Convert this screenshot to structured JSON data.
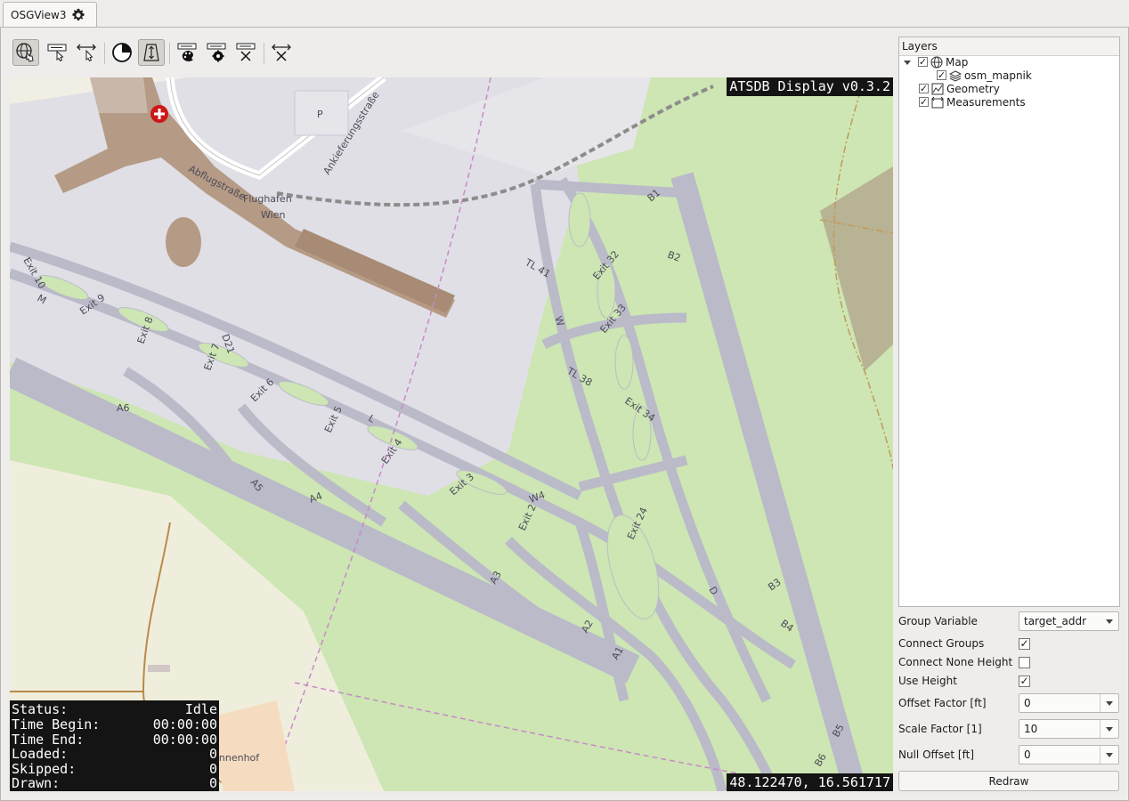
{
  "tab": {
    "title": "OSGView3",
    "icon": "gear-icon"
  },
  "toolbar": {
    "buttons": [
      {
        "name": "navigate-map-icon",
        "active": true
      },
      {
        "name": "select-label-icon",
        "active": false
      },
      {
        "name": "measure-distance-icon",
        "active": false
      },
      {
        "name": "time-filter-icon",
        "active": false
      },
      {
        "name": "height-mode-icon",
        "active": true
      },
      {
        "name": "label-style-icon",
        "active": false
      },
      {
        "name": "label-settings-icon",
        "active": false
      },
      {
        "name": "clear-labels-icon",
        "active": false
      },
      {
        "name": "clear-distances-icon",
        "active": false
      }
    ]
  },
  "map": {
    "overlay_title": "ATSDB Display v0.3.2",
    "coordinates": "48.122470, 16.561717",
    "labels": {
      "airport_name_1": "Flughafen",
      "airport_name_2": "Wien",
      "abflug": "Abflugstraße",
      "ankunft": "Ankieferungsstraße",
      "parking": "P",
      "village": "Kaiserinnenhof"
    },
    "taxiway_labels": [
      "B1",
      "B2",
      "B3",
      "B4",
      "B5",
      "B6",
      "Exit 32",
      "Exit 33",
      "Exit 34",
      "TL 41",
      "TL 38",
      "W",
      "W4",
      "Exit 24",
      "Exit 2",
      "Exit 3",
      "Exit 4",
      "Exit 5",
      "Exit 6",
      "Exit 7",
      "Exit 8",
      "Exit 9",
      "Exit 10",
      "A1",
      "A2",
      "A3",
      "A4",
      "A5",
      "A6",
      "D",
      "D21",
      "M",
      "L"
    ]
  },
  "status": {
    "rows": [
      {
        "label": "Status:",
        "value": "Idle"
      },
      {
        "label": "Time Begin:",
        "value": "00:00:00"
      },
      {
        "label": "Time End:",
        "value": "00:00:00"
      },
      {
        "label": "Loaded:",
        "value": "0"
      },
      {
        "label": "Skipped:",
        "value": "0"
      },
      {
        "label": "Drawn:",
        "value": "0"
      }
    ]
  },
  "layers": {
    "header": "Layers",
    "items": [
      {
        "label": "Map",
        "checked": true,
        "icon": "globe-icon",
        "expanded": true
      },
      {
        "label": "osm_mapnik",
        "checked": true,
        "icon": "layers-icon"
      },
      {
        "label": "Geometry",
        "checked": true,
        "icon": "geometry-icon"
      },
      {
        "label": "Measurements",
        "checked": true,
        "icon": "measurements-icon"
      }
    ]
  },
  "settings": {
    "group_variable": {
      "label": "Group Variable",
      "value": "target_addr"
    },
    "connect_groups": {
      "label": "Connect Groups",
      "checked": true
    },
    "connect_none_height": {
      "label": "Connect None Height",
      "checked": false
    },
    "use_height": {
      "label": "Use Height",
      "checked": true
    },
    "offset_factor": {
      "label": "Offset Factor [ft]",
      "value": "0"
    },
    "scale_factor": {
      "label": "Scale Factor [1]",
      "value": "10"
    },
    "null_offset": {
      "label": "Null Offset [ft]",
      "value": "0"
    },
    "redraw_label": "Redraw"
  },
  "colors": {
    "grass": "#cde6b3",
    "apron": "#e0dfe6",
    "taxiway": "#babac9",
    "terminal": "#b59a85",
    "land": "#f1efe3",
    "overlay_bg": "#141414"
  }
}
